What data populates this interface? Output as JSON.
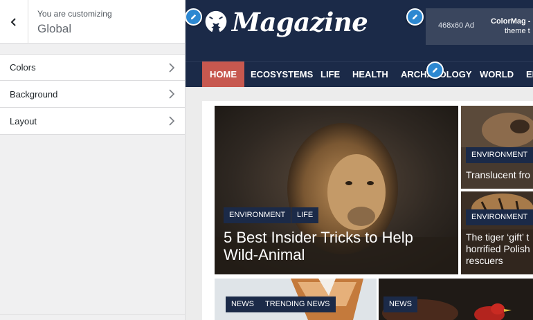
{
  "customizer": {
    "caption": "You are customizing",
    "title": "Global",
    "sections": [
      {
        "label": "Colors"
      },
      {
        "label": "Background"
      },
      {
        "label": "Layout"
      }
    ]
  },
  "site": {
    "logo_text": "Magazine",
    "ad": {
      "size_label": "468x60 Ad",
      "text_line1": "ColorMag -",
      "text_line2": "theme t"
    },
    "nav": [
      "HOME",
      "ECOSYSTEMS",
      "LIFE",
      "HEALTH",
      "ARCHAEOLOGY",
      "WORLD",
      "EN"
    ],
    "featured": {
      "tags": [
        "ENVIRONMENT",
        "LIFE"
      ],
      "title_line1": "5 Best Insider Tricks to Help",
      "title_line2": "Wild-Animal"
    },
    "side_posts": [
      {
        "tag": "ENVIRONMENT",
        "title": "Translucent fro"
      },
      {
        "tag": "ENVIRONMENT",
        "title_line1": "The tiger ‘gift’ t",
        "title_line2": "horrified Polish",
        "title_line3": "rescuers"
      }
    ],
    "bottom_posts": [
      {
        "tags": [
          "NEWS",
          "TRENDING NEWS"
        ]
      },
      {
        "tags": [
          "NEWS"
        ]
      }
    ]
  },
  "colors": {
    "header_bg": "#1b2a48",
    "nav_active": "#c7584f",
    "edit_pin": "#2d88d1"
  }
}
